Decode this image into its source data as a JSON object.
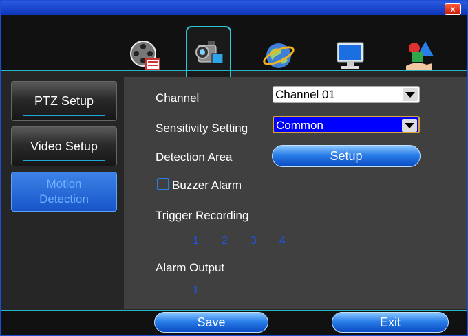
{
  "window": {
    "close_label": "x"
  },
  "top_tabs": [
    {
      "icon": "film-reel-icon"
    },
    {
      "icon": "camera-icon",
      "active": true
    },
    {
      "icon": "globe-icon"
    },
    {
      "icon": "monitor-icon"
    },
    {
      "icon": "shapes-hand-icon"
    }
  ],
  "sidebar": {
    "items": [
      {
        "label": "PTZ Setup"
      },
      {
        "label": "Video Setup"
      },
      {
        "label_line1": "Motion",
        "label_line2": "Detection",
        "active": true
      }
    ]
  },
  "form": {
    "channel_label": "Channel",
    "channel_value": "Channel 01",
    "sensitivity_label": "Sensitivity Setting",
    "sensitivity_value": "Common",
    "detection_area_label": "Detection Area",
    "setup_button": "Setup",
    "buzzer_label": "Buzzer Alarm",
    "buzzer_checked": false,
    "trigger_label": "Trigger Recording",
    "trigger_channels": [
      "1",
      "2",
      "3",
      "4"
    ],
    "alarm_output_label": "Alarm Output",
    "alarm_outputs": [
      "1"
    ]
  },
  "footer": {
    "save_label": "Save",
    "exit_label": "Exit"
  },
  "colors": {
    "accent": "#27b6c6",
    "button_blue": "#2a7ee8",
    "number_blue": "#1a56e8",
    "highlight_select": "#0000ff"
  }
}
